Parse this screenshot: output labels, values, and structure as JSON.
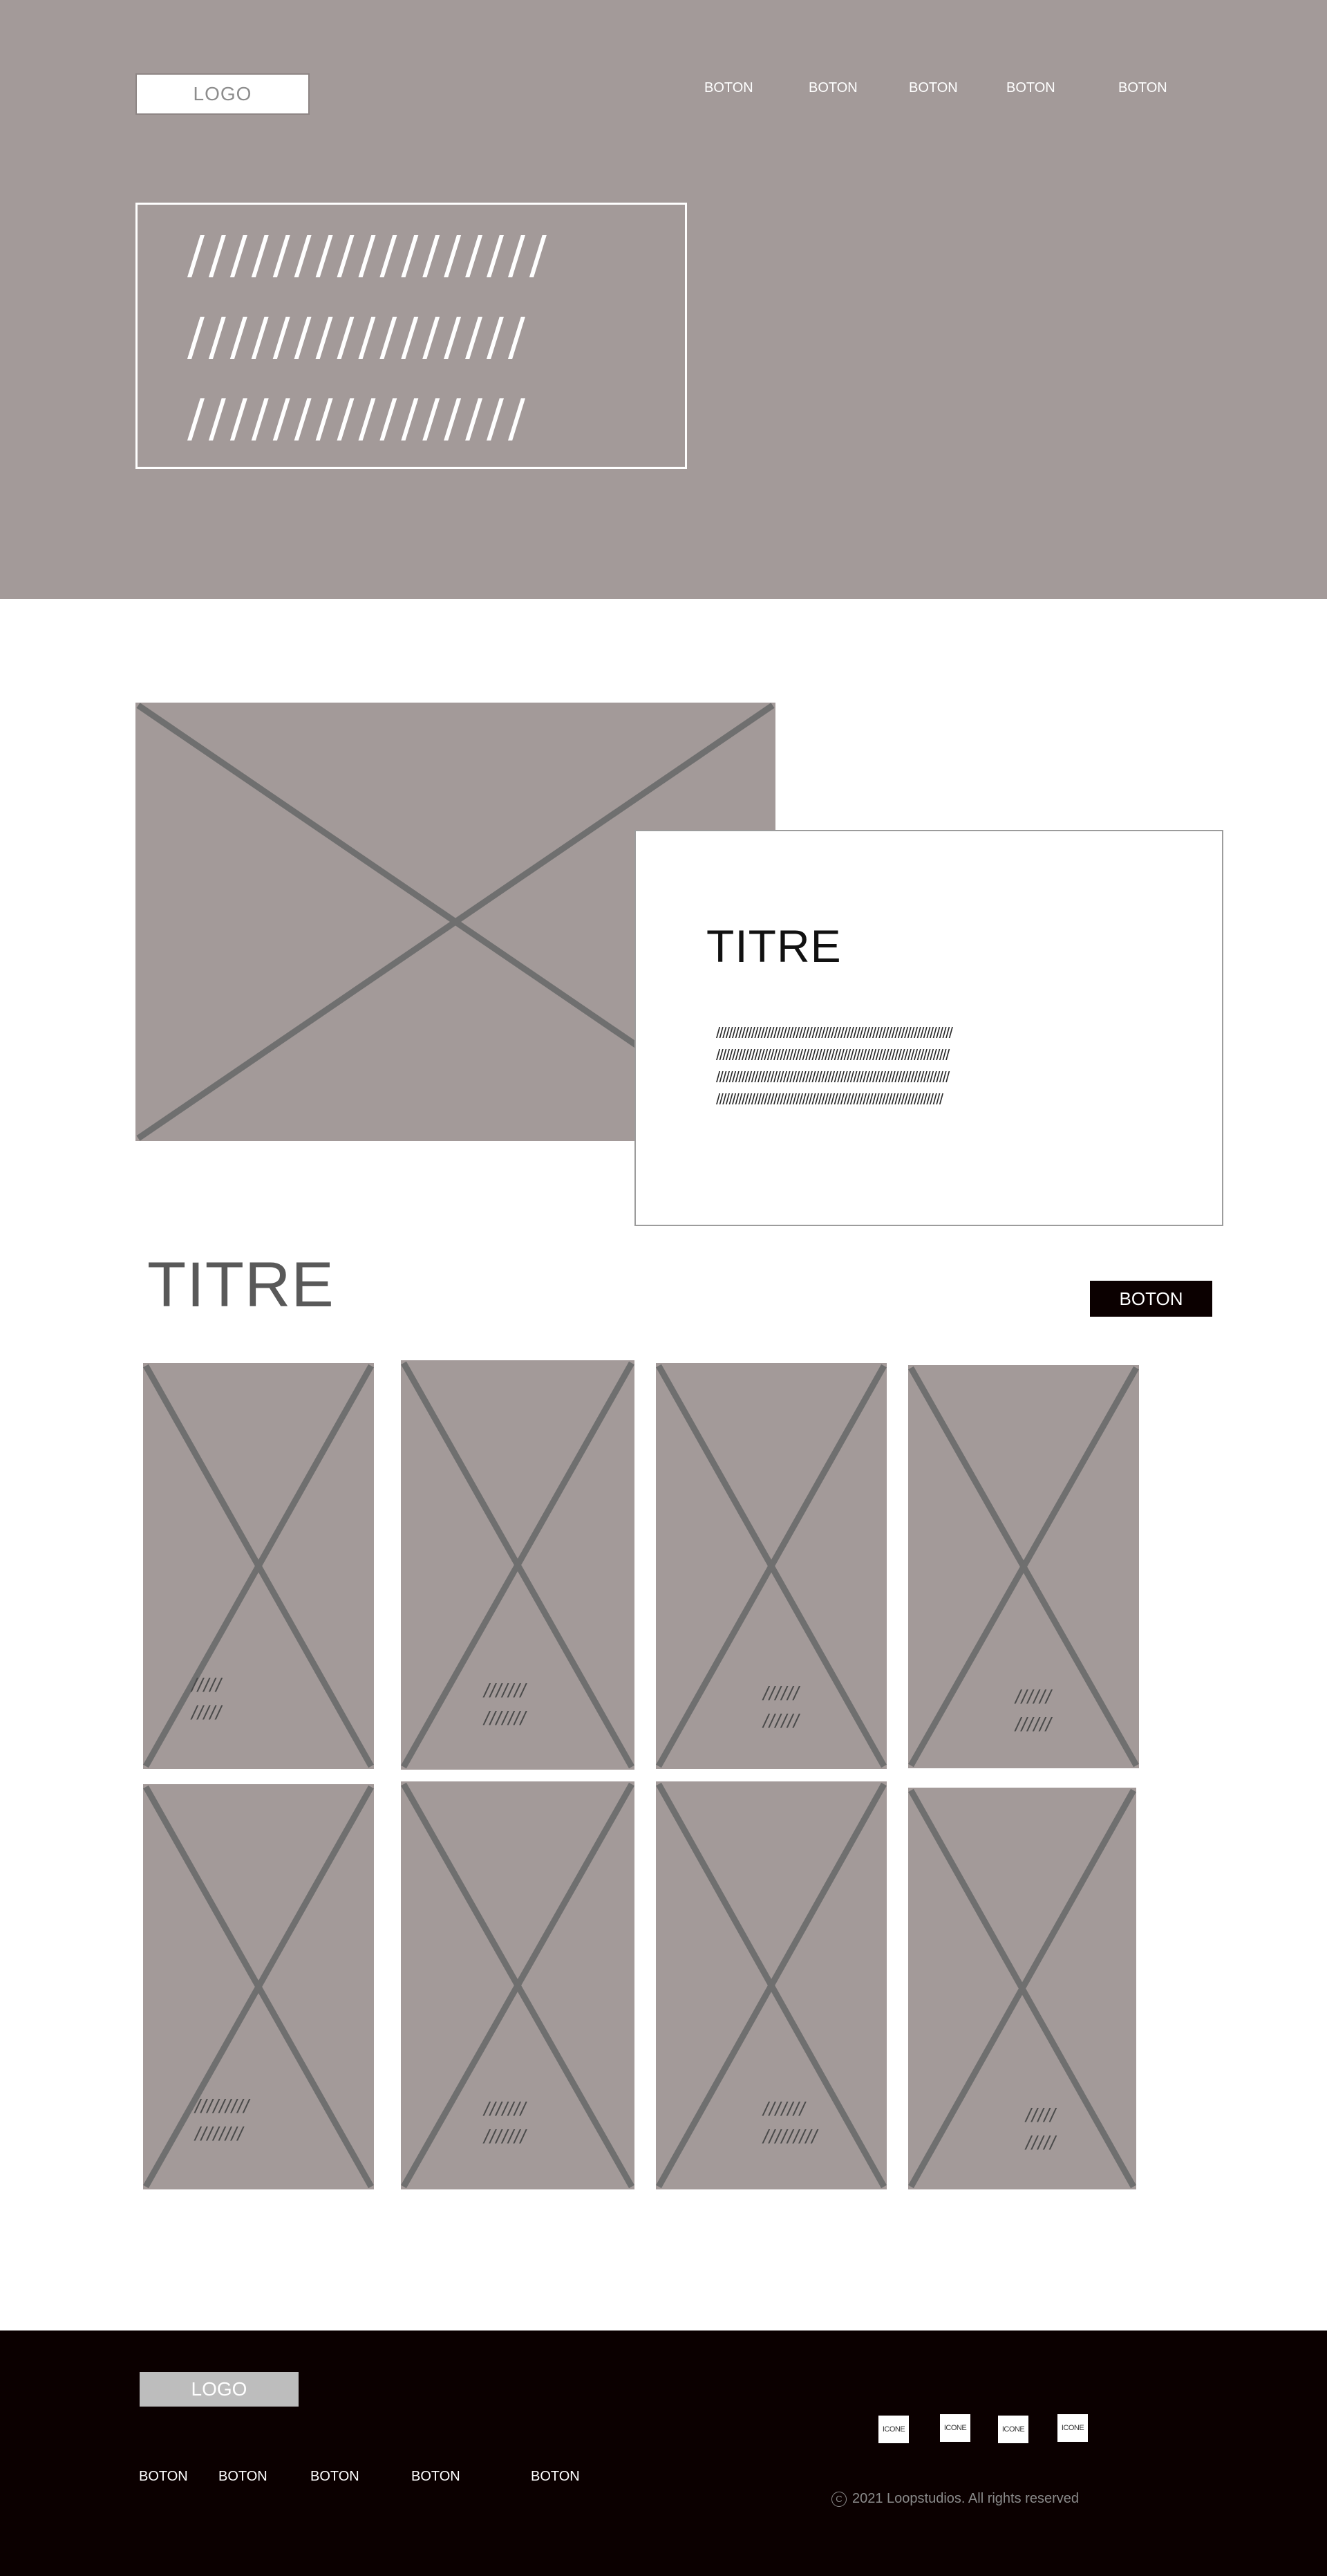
{
  "header": {
    "logo": "LOGO",
    "nav": [
      "BOTON",
      "BOTON",
      "BOTON",
      "BOTON",
      "BOTON"
    ]
  },
  "hero": {
    "lines": [
      "/////////////////",
      "////////////////",
      "////////////////"
    ]
  },
  "feature": {
    "title": "TITRE",
    "lines": [
      "//////////////////////////////////////////////////////////////////////////",
      "/////////////////////////////////////////////////////////////////////////",
      "/////////////////////////////////////////////////////////////////////////",
      "///////////////////////////////////////////////////////////////////////"
    ]
  },
  "gallery": {
    "title": "TITRE",
    "button": "BOTON",
    "cards": [
      {
        "lines": [
          "/////",
          "/////"
        ]
      },
      {
        "lines": [
          "///////",
          "///////"
        ]
      },
      {
        "lines": [
          "//////",
          "//////"
        ]
      },
      {
        "lines": [
          "//////",
          "//////"
        ]
      },
      {
        "lines": [
          "/////////",
          "////////"
        ]
      },
      {
        "lines": [
          "///////",
          "///////"
        ]
      },
      {
        "lines": [
          "///////",
          "/////////"
        ]
      },
      {
        "lines": [
          "/////",
          "/////"
        ]
      }
    ]
  },
  "footer": {
    "logo": "LOGO",
    "nav": [
      "BOTON",
      "BOTON",
      "BOTON",
      "BOTON",
      "BOTON"
    ],
    "icons": [
      "ICONE",
      "ICONE",
      "ICONE",
      "ICONE"
    ],
    "copyright_symbol": "C",
    "copyright": "2021 Loopstudios. All rights reserved"
  },
  "colors": {
    "hero_bg": "#a39a99",
    "placeholder_stroke": "#6f6f6f",
    "footer_bg": "#0b0000"
  }
}
